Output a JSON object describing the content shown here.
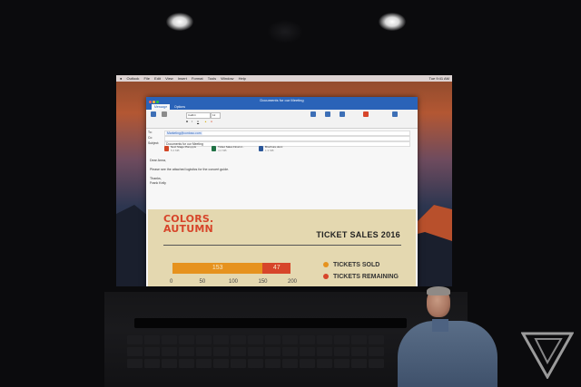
{
  "menubar": {
    "items": [
      "Outlook",
      "File",
      "Edit",
      "View",
      "Insert",
      "Format",
      "Tools",
      "Window",
      "Help"
    ],
    "clock": "Tue 9:41 AM"
  },
  "window": {
    "title": "Documents for our Meeting",
    "tabs": [
      "Message",
      "Options"
    ],
    "font_name": "Calibri",
    "font_size": "12",
    "ribbon_right": [
      "Signature",
      "Office Add-ins",
      "Attach File",
      "Check Names",
      "High Priority",
      "Low Priority",
      "Dictate"
    ]
  },
  "compose": {
    "to_label": "To:",
    "to_value": "Marketing@contoso.com",
    "cc_label": "Cc:",
    "subject_label": "Subject:",
    "subject_value": "Documents for our Meeting",
    "attachments": [
      {
        "name": "Next Stage Plan.pptx",
        "size": "5.4 MB",
        "color": "#d24726"
      },
      {
        "name": "Ticket Sales Final.xl...",
        "size": "4.2 MB",
        "color": "#207245"
      },
      {
        "name": "Brochure.docx",
        "size": "1.3 MB",
        "color": "#2b579a"
      }
    ],
    "body_lines": [
      "Dear Anna,",
      "Please see the attached logistics for the concert guide.",
      "Thanks,",
      "Frank Kelly"
    ]
  },
  "infographic": {
    "logo_line1": "COLORS.",
    "logo_line2": "AUTUMN",
    "title": "TICKET SALES 2016",
    "legend": [
      {
        "label": "TICKETS SOLD",
        "color": "#e6921e"
      },
      {
        "label": "TICKETS REMAINING",
        "color": "#d7452a"
      }
    ]
  },
  "chart_data": {
    "type": "bar",
    "orientation": "horizontal",
    "stacked": true,
    "title": "TICKET SALES 2016",
    "series": [
      {
        "name": "TICKETS SOLD",
        "values": [
          153
        ],
        "color": "#e6921e"
      },
      {
        "name": "TICKETS REMAINING",
        "values": [
          47
        ],
        "color": "#d7452a"
      }
    ],
    "xlim": [
      0,
      200
    ],
    "xticks": [
      "0",
      "50",
      "100",
      "150",
      "200"
    ],
    "grid": false,
    "legend_position": "right"
  }
}
